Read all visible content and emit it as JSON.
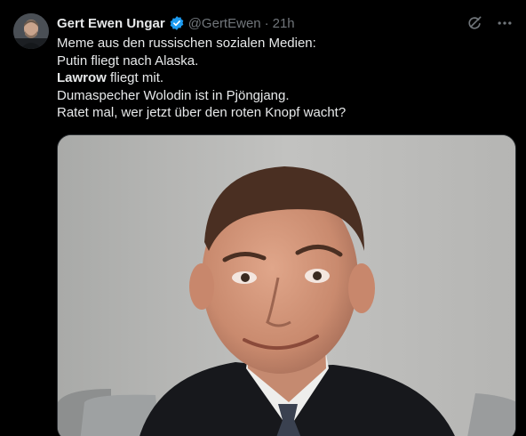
{
  "author": {
    "display_name": "Gert Ewen Ungar",
    "handle": "@GertEwen",
    "separator": "·",
    "time": "21h",
    "verified_color": "#1d9bf0"
  },
  "post": {
    "line1": "Meme aus den russischen sozialen Medien:",
    "line2": "Putin fliegt nach Alaska.",
    "line3_bold": "Lawrow",
    "line3_rest": " fliegt mit.",
    "line4": "Dumaspecher Wolodin ist in Pjöngjang.",
    "line5": "Ratet mal, wer jetzt über den roten Knopf wacht?"
  },
  "icons": {
    "grok": "grok-icon",
    "more": "more-icon",
    "verified": "verified-badge-icon"
  },
  "colors": {
    "background": "#000000",
    "text": "#e7e9ea",
    "secondary": "#71767b",
    "accent": "#1d9bf0"
  }
}
